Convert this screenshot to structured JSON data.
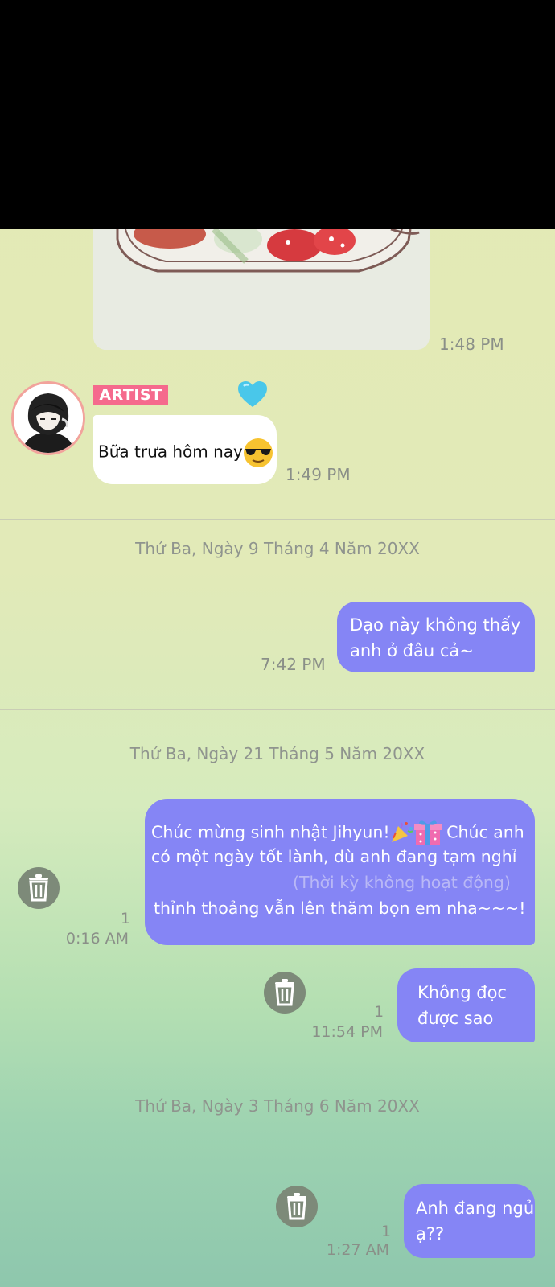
{
  "messages": {
    "photo_time": "1:48 PM",
    "artist_badge": "ARTIST",
    "lunch_text": "Bữa trưa hôm nay",
    "lunch_time": "1:49 PM",
    "date1": "Thứ Ba, Ngày 9 Tháng 4 Năm 20XX",
    "msg1_line1": "Dạo này không thấy",
    "msg1_line2": "anh ở đâu cả~",
    "msg1_time": "7:42 PM",
    "date2": "Thứ Ba, Ngày 21 Tháng 5 Năm 20XX",
    "msg2_part1": "Chúc mừng sinh nhật Jihyun!",
    "msg2_part2": " Chúc anh",
    "msg2_line2": "có một ngày tốt lành, dù anh đang tạm nghỉ",
    "msg2_line3": "(Thời kỳ không hoạt động)",
    "msg2_line4": "thỉnh thoảng vẫn lên thăm bọn em nha~~~!",
    "msg2_unread": "1",
    "msg2_time": "0:16 AM",
    "msg3_line1": "Không đọc",
    "msg3_line2": "được sao",
    "msg3_unread": "1",
    "msg3_time": "11:54 PM",
    "date3": "Thứ Ba, Ngày 3 Tháng 6 Năm 20XX",
    "msg4_line1": "Anh đang ngủ",
    "msg4_line2": "ạ??",
    "msg4_unread": "1",
    "msg4_time": "1:27 AM"
  },
  "colors": {
    "sent_bubble": "#8585f5",
    "artist_badge": "#f56a8d",
    "trash_icon_bg": "#7d8a79"
  }
}
